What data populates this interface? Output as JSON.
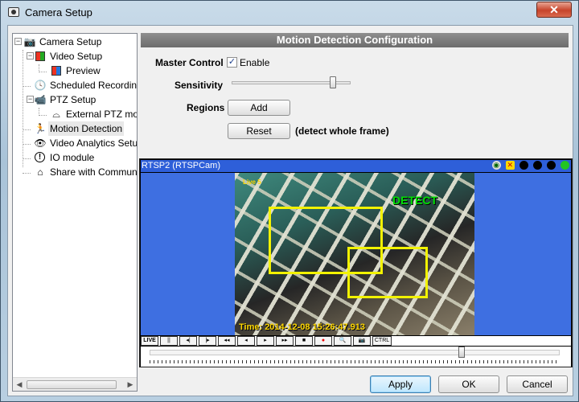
{
  "window": {
    "title": "Camera Setup",
    "close_glyph": "✕"
  },
  "tree": {
    "items": [
      {
        "label": "Camera Setup",
        "icon": "camera-icon"
      },
      {
        "label": "Video Setup",
        "icon": "video-setup-icon"
      },
      {
        "label": "Preview",
        "icon": "preview-icon"
      },
      {
        "label": "Scheduled Recording",
        "icon": "clock-icon"
      },
      {
        "label": "PTZ Setup",
        "icon": "ptz-camera-icon"
      },
      {
        "label": "External PTZ mod",
        "icon": "dome-camera-icon"
      },
      {
        "label": "Motion Detection",
        "icon": "running-person-icon"
      },
      {
        "label": "Video Analytics Setup",
        "icon": "eye-icon"
      },
      {
        "label": "IO module",
        "icon": "info-icon"
      },
      {
        "label": "Share with Communit",
        "icon": "house-icon"
      }
    ],
    "expanders": [
      "−",
      "−",
      "−"
    ],
    "scroll_left": "◀",
    "scroll_right": "▶"
  },
  "panel": {
    "header": "Motion Detection Configuration",
    "master_control_label": "Master Control",
    "enable_label": "Enable",
    "enable_checked": true,
    "check_glyph": "✓",
    "sensitivity_label": "Sensitivity",
    "sensitivity_value": 0.85,
    "regions_label": "Regions",
    "add_button": "Add",
    "reset_button": "Reset",
    "reset_note": "(detect whole frame)"
  },
  "video": {
    "title": "RTSP2 (RTSPCam)",
    "live_badge": "Live 5",
    "detect_label": "DETECT",
    "timestamp": "Time: 2014-12-08 15:26:47.913",
    "status_colors": [
      "#000000",
      "#000000",
      "#000000",
      "#22c522"
    ],
    "controls": [
      "LIVE",
      "||",
      "◂|",
      "|▸",
      "◂◂",
      "◂",
      "▸",
      "▸▸",
      "■",
      "●",
      "🔍",
      "📷",
      "CTRL"
    ],
    "seek_position": 0.76
  },
  "footer": {
    "apply": "Apply",
    "ok": "OK",
    "cancel": "Cancel"
  }
}
